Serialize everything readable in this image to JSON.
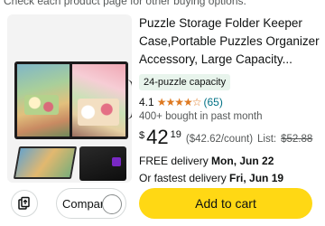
{
  "top_note": "Check each product page for other buying options.",
  "product": {
    "title_lines": [
      "Puzzle Storage Folder Keeper",
      "Case,Portable Puzzles Organizer",
      "Accessory, Large Capacity..."
    ],
    "badge": "24-puzzle capacity",
    "rating": "4.1",
    "stars": "★★★★☆",
    "review_count": "(65)",
    "bought": "400+ bought in past month",
    "price_currency": "$",
    "price_whole": "42",
    "price_cents": "19",
    "unit_price": "($42.62/count)",
    "list_label": "List:",
    "list_price": "$52.88",
    "delivery_prefix": "FREE delivery",
    "delivery_date": "Mon, Jun 22",
    "fast_prefix": "Or fastest delivery",
    "fast_date": "Fri, Jun 19"
  },
  "actions": {
    "compare_label": "Compare",
    "add_to_cart_label": "Add to cart",
    "share_icon": "share-icon"
  },
  "colors": {
    "cart_button": "#ffd814",
    "star": "#de7921",
    "link": "#007185",
    "badge_bg": "#e8f4ec"
  }
}
